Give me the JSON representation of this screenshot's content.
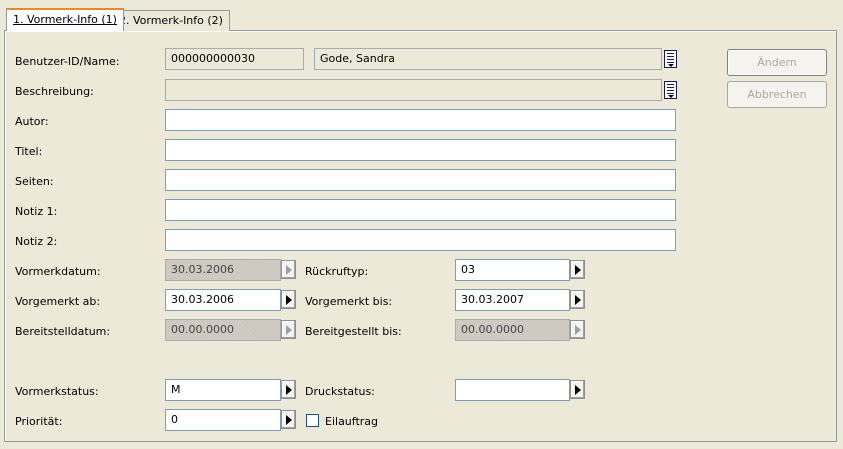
{
  "tabs": [
    {
      "label": "1. Vormerk-Info (1)"
    },
    {
      "label": "2. Vormerk-Info (2)"
    }
  ],
  "labels": {
    "benutzer": "Benutzer-ID/Name:",
    "beschreibung": "Beschreibung:",
    "autor": "Autor:",
    "titel": "Titel:",
    "seiten": "Seiten:",
    "notiz1": "Notiz 1:",
    "notiz2": "Notiz 2:",
    "vormerkdatum": "Vormerkdatum:",
    "vorgemerkt_ab": "Vorgemerkt ab:",
    "bereitstelldatum": "Bereitstelldatum:",
    "vormerkstatus": "Vormerkstatus:",
    "prioritaet": "Priorität:",
    "rueckruftyp": "Rückruftyp:",
    "vorgemerkt_bis": "Vorgemerkt bis:",
    "bereitgestellt_bis": "Bereitgestellt bis:",
    "druckstatus": "Druckstatus:",
    "eilauftrag": "Eilauftrag"
  },
  "values": {
    "benutzer_id": "000000000030",
    "benutzer_name": "Gode, Sandra",
    "beschreibung": "",
    "autor": "",
    "titel": "",
    "seiten": "",
    "notiz1": "",
    "notiz2": "",
    "vormerkdatum": "30.03.2006",
    "vorgemerkt_ab": "30.03.2006",
    "bereitstelldatum": "00.00.0000",
    "vormerkstatus": "M",
    "prioritaet": "0",
    "rueckruftyp": "03",
    "vorgemerkt_bis": "30.03.2007",
    "bereitgestellt_bis": "00.00.0000",
    "druckstatus": "",
    "eilauftrag_checked": false
  },
  "buttons": {
    "aendern": "Ändern",
    "abbrechen": "Abbrechen"
  }
}
